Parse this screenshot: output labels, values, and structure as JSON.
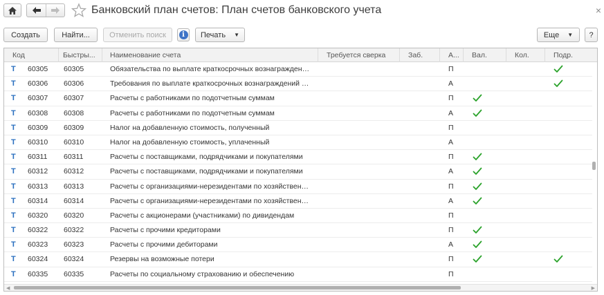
{
  "window": {
    "title": "Банковский план счетов: План счетов банковского учета",
    "close_glyph": "×"
  },
  "toolbar": {
    "create": "Создать",
    "find": "Найти...",
    "cancel_search": "Отменить поиск",
    "info": "i",
    "print": "Печать",
    "more": "Еще",
    "help": "?"
  },
  "columns": [
    "Код",
    "Быстры...",
    "Наименование счета",
    "Требуется сверка",
    "Заб.",
    "А...",
    "Вал.",
    "Кол.",
    "Подр."
  ],
  "accent_colors": {
    "check": "#2aa22a",
    "type_icon": "#2a6fbf"
  },
  "rows": [
    {
      "type": "Т",
      "code": "60305",
      "fast": "60305",
      "name": "Обязательства по выплате краткосрочных вознаграждений раб...",
      "ap": "П",
      "val": false,
      "podr": true
    },
    {
      "type": "Т",
      "code": "60306",
      "fast": "60306",
      "name": "Требования по выплате краткосрочных вознаграждений работн...",
      "ap": "А",
      "val": false,
      "podr": true
    },
    {
      "type": "Т",
      "code": "60307",
      "fast": "60307",
      "name": "Расчеты с работниками по подотчетным суммам",
      "ap": "П",
      "val": true,
      "podr": false
    },
    {
      "type": "Т",
      "code": "60308",
      "fast": "60308",
      "name": "Расчеты с работниками по подотчетным суммам",
      "ap": "А",
      "val": true,
      "podr": false
    },
    {
      "type": "Т",
      "code": "60309",
      "fast": "60309",
      "name": "Налог на добавленную стоимость, полученный",
      "ap": "П",
      "val": false,
      "podr": false
    },
    {
      "type": "Т",
      "code": "60310",
      "fast": "60310",
      "name": "Налог на добавленную стоимость, уплаченный",
      "ap": "А",
      "val": false,
      "podr": false
    },
    {
      "type": "Т",
      "code": "60311",
      "fast": "60311",
      "name": "Расчеты с поставщиками, подрядчиками и покупателями",
      "ap": "П",
      "val": true,
      "podr": false
    },
    {
      "type": "Т",
      "code": "60312",
      "fast": "60312",
      "name": "Расчеты с поставщиками, подрядчиками и покупателями",
      "ap": "А",
      "val": true,
      "podr": false
    },
    {
      "type": "Т",
      "code": "60313",
      "fast": "60313",
      "name": "Расчеты с организациями-нерезидентами по хозяйственным оп...",
      "ap": "П",
      "val": true,
      "podr": false
    },
    {
      "type": "Т",
      "code": "60314",
      "fast": "60314",
      "name": "Расчеты с организациями-нерезидентами по хозяйственным оп...",
      "ap": "А",
      "val": true,
      "podr": false
    },
    {
      "type": "Т",
      "code": "60320",
      "fast": "60320",
      "name": "Расчеты с акционерами (участниками) по дивидендам",
      "ap": "П",
      "val": false,
      "podr": false
    },
    {
      "type": "Т",
      "code": "60322",
      "fast": "60322",
      "name": "Расчеты с прочими кредиторами",
      "ap": "П",
      "val": true,
      "podr": false
    },
    {
      "type": "Т",
      "code": "60323",
      "fast": "60323",
      "name": "Расчеты с прочими дебиторами",
      "ap": "А",
      "val": true,
      "podr": false
    },
    {
      "type": "Т",
      "code": "60324",
      "fast": "60324",
      "name": "Резервы на возможные потери",
      "ap": "П",
      "val": true,
      "podr": true
    },
    {
      "type": "Т",
      "code": "60335",
      "fast": "60335",
      "name": "Расчеты по социальному страхованию и обеспечению",
      "ap": "П",
      "val": false,
      "podr": false
    }
  ]
}
